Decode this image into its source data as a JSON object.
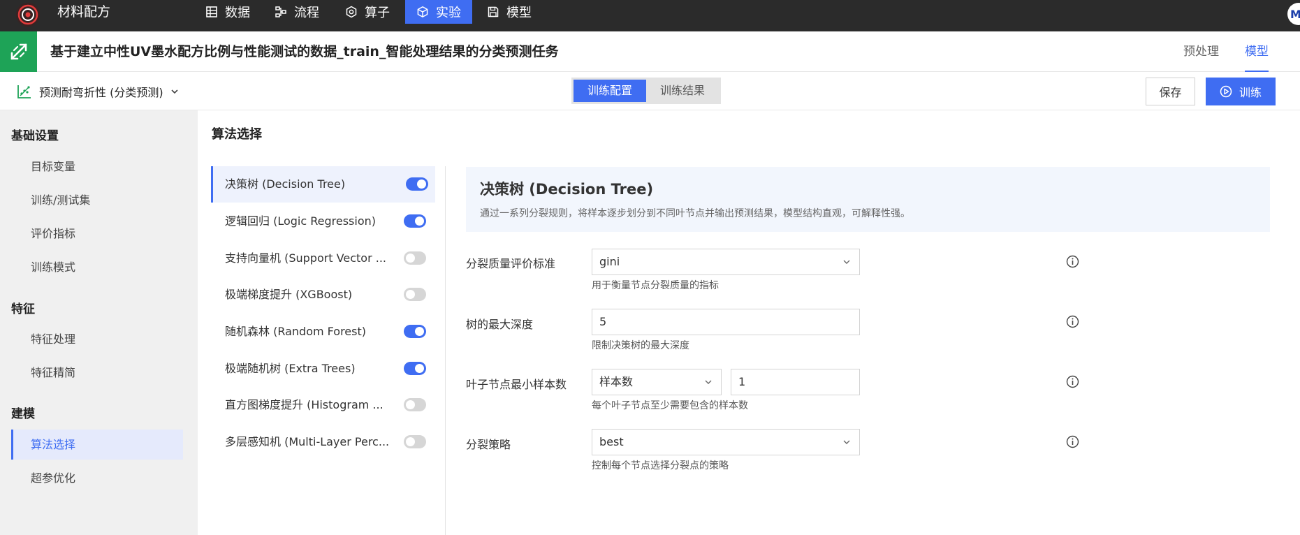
{
  "app": {
    "title": "材料配方"
  },
  "nav": {
    "items": [
      {
        "label": "数据",
        "icon": "table-icon"
      },
      {
        "label": "流程",
        "icon": "flow-icon"
      },
      {
        "label": "算子",
        "icon": "operator-icon"
      },
      {
        "label": "实验",
        "icon": "cube-icon",
        "active": true
      },
      {
        "label": "模型",
        "icon": "save-icon"
      }
    ],
    "avatar_letter": "M"
  },
  "task": {
    "title": "基于建立中性UV墨水配方比例与性能测试的数据_train_智能处理结果的分类预测任务",
    "tabs": [
      {
        "label": "预处理",
        "active": false
      },
      {
        "label": "模型",
        "active": true
      }
    ]
  },
  "toolbar": {
    "target": "预测耐弯折性 (分类预测)",
    "segments": [
      {
        "label": "训练配置",
        "active": true
      },
      {
        "label": "训练结果",
        "active": false
      }
    ],
    "save_label": "保存",
    "train_label": "训练"
  },
  "sidebar": {
    "sections": [
      {
        "title": "基础设置",
        "items": [
          "目标变量",
          "训练/测试集",
          "评价指标",
          "训练模式"
        ]
      },
      {
        "title": "特征",
        "items": [
          "特征处理",
          "特征精简"
        ]
      },
      {
        "title": "建模",
        "items": [
          "算法选择",
          "超参优化"
        ]
      }
    ],
    "active_item": "算法选择"
  },
  "main": {
    "section_title": "算法选择",
    "algorithms": [
      {
        "label": "决策树 (Decision Tree)",
        "enabled": true,
        "selected": true
      },
      {
        "label": "逻辑回归 (Logic Regression)",
        "enabled": true,
        "selected": false
      },
      {
        "label": "支持向量机 (Support Vector ...",
        "enabled": false,
        "selected": false
      },
      {
        "label": "极端梯度提升 (XGBoost)",
        "enabled": false,
        "selected": false
      },
      {
        "label": "随机森林 (Random Forest)",
        "enabled": true,
        "selected": false
      },
      {
        "label": "极端随机树 (Extra Trees)",
        "enabled": true,
        "selected": false
      },
      {
        "label": "直方图梯度提升 (Histogram ...",
        "enabled": false,
        "selected": false
      },
      {
        "label": "多层感知机 (Multi-Layer Perc...",
        "enabled": false,
        "selected": false
      }
    ],
    "detail": {
      "name": "决策树 (Decision Tree)",
      "description": "通过一系列分裂规则，将样本逐步划分到不同叶节点并输出预测结果，模型结构直观，可解释性强。"
    },
    "params": {
      "criterion": {
        "label": "分裂质量评价标准",
        "value": "gini",
        "hint": "用于衡量节点分裂质量的指标"
      },
      "max_depth": {
        "label": "树的最大深度",
        "value": "5",
        "hint": "限制决策树的最大深度"
      },
      "min_samples_leaf": {
        "label": "叶子节点最小样本数",
        "mode": "样本数",
        "value": "1",
        "hint": "每个叶子节点至少需要包含的样本数"
      },
      "splitter": {
        "label": "分裂策略",
        "value": "best",
        "hint": "控制每个节点选择分裂点的策略"
      }
    }
  },
  "colors": {
    "accent": "#3f6df2",
    "brand_green": "#1ea357",
    "topbar": "#2b2b2b"
  }
}
